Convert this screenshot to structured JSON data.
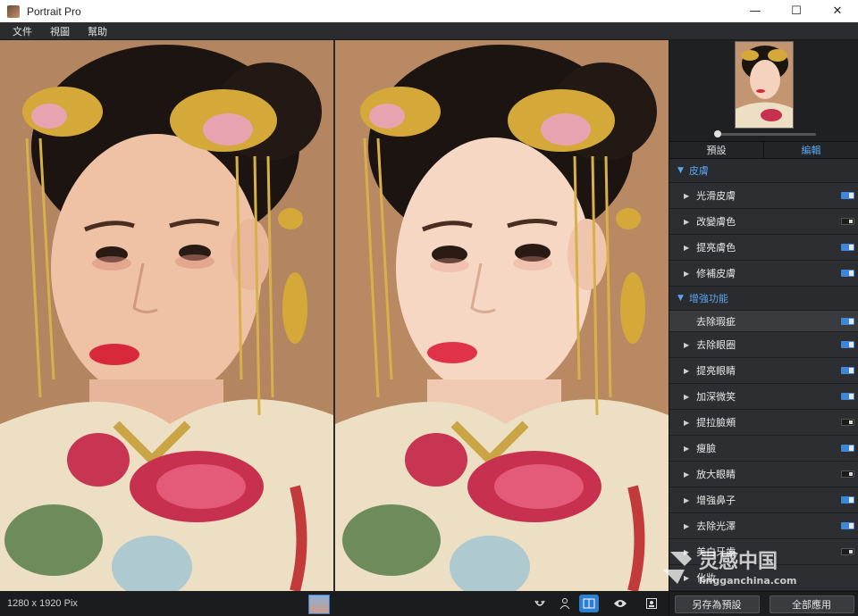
{
  "window": {
    "title": "Portrait Pro",
    "minimize": "—",
    "maximize": "☐",
    "close": "✕"
  },
  "menu": [
    "文件",
    "視圖",
    "幫助"
  ],
  "status": {
    "dimensions": "1280 x 1920 Pix"
  },
  "panel": {
    "tabs": [
      {
        "label": "預設",
        "active": false
      },
      {
        "label": "編輯",
        "active": true
      }
    ],
    "sections": [
      {
        "title": "皮膚",
        "items": [
          {
            "label": "光滑皮膚",
            "on": true
          },
          {
            "label": "改變膚色",
            "on": false
          },
          {
            "label": "提亮膚色",
            "on": true
          },
          {
            "label": "修補皮膚",
            "on": true
          }
        ]
      },
      {
        "title": "增強功能",
        "items": [
          {
            "label": "去除瑕疵",
            "on": true,
            "sub": true
          },
          {
            "label": "去除眼圈",
            "on": true
          },
          {
            "label": "提亮眼睛",
            "on": true
          },
          {
            "label": "加深微笑",
            "on": true
          },
          {
            "label": "提拉臉頰",
            "on": false
          },
          {
            "label": "瘦臉",
            "on": true
          },
          {
            "label": "放大眼睛",
            "on": false
          },
          {
            "label": "增強鼻子",
            "on": true
          },
          {
            "label": "去除光澤",
            "on": true
          },
          {
            "label": "美白牙齒",
            "on": false
          },
          {
            "label": "化妝",
            "on": false
          }
        ]
      }
    ],
    "footer": {
      "save_preset": "另存為預設",
      "apply_all": "全部應用"
    }
  },
  "watermark": {
    "cn": "灵感中国",
    "en": "lingganchina.com"
  }
}
